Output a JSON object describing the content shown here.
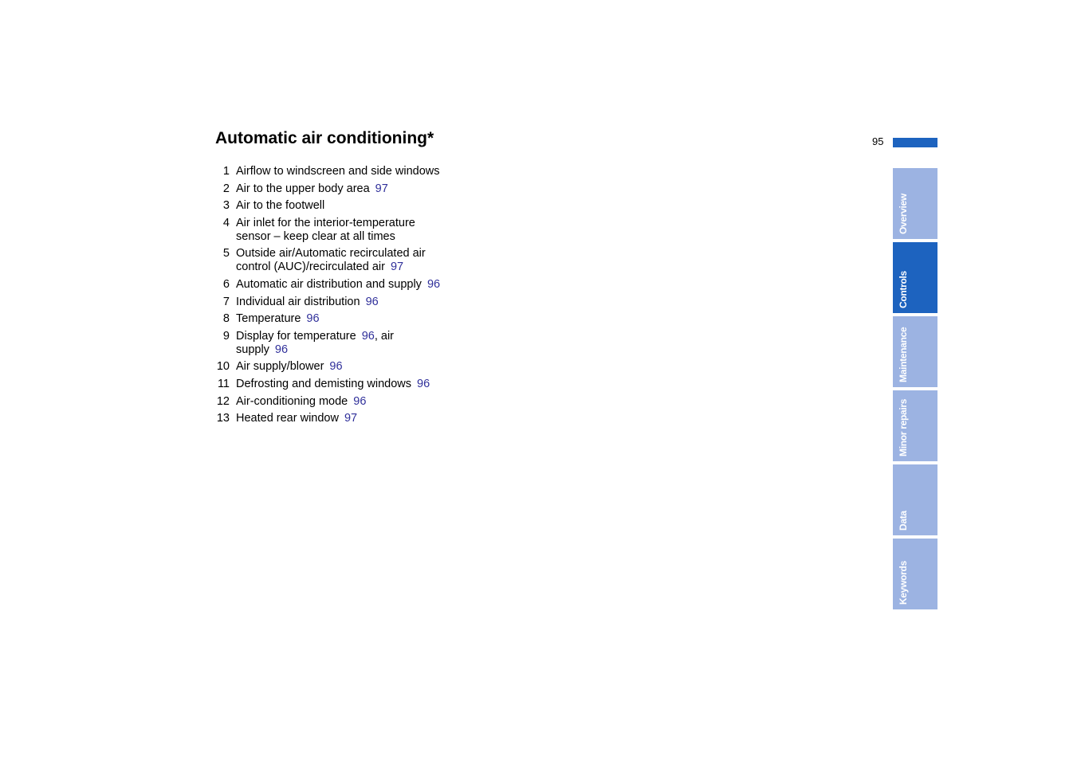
{
  "header": {
    "title": "Automatic air conditioning*",
    "page_number": "95"
  },
  "items": [
    {
      "num": "1",
      "text": "Airflow to windscreen and side windows",
      "refs": []
    },
    {
      "num": "2",
      "text": "Air to the upper body area",
      "refs": [
        "97"
      ]
    },
    {
      "num": "3",
      "text": "Air to the footwell",
      "refs": []
    },
    {
      "num": "4",
      "text": "Air inlet for the interior-temperature sensor – keep clear at all times",
      "refs": []
    },
    {
      "num": "5",
      "text": "Outside air/Automatic recirculated air control (AUC)/recirculated air",
      "refs": [
        "97"
      ]
    },
    {
      "num": "6",
      "text": "Automatic air distribution and supply",
      "refs": [
        "96"
      ]
    },
    {
      "num": "7",
      "text": "Individual air distribution",
      "refs": [
        "96"
      ]
    },
    {
      "num": "8",
      "text": "Temperature",
      "refs": [
        "96"
      ]
    },
    {
      "num": "9",
      "text": "Display for temperature",
      "refs": [
        "96"
      ],
      "text2": ", air supply",
      "refs2": [
        "96"
      ]
    },
    {
      "num": "10",
      "text": "Air supply/blower",
      "refs": [
        "96"
      ]
    },
    {
      "num": "11",
      "text": "Defrosting and demisting windows",
      "refs": [
        "96"
      ]
    },
    {
      "num": "12",
      "text": "Air-conditioning mode",
      "refs": [
        "96"
      ]
    },
    {
      "num": "13",
      "text": "Heated rear window",
      "refs": [
        "97"
      ]
    }
  ],
  "sidebar": {
    "tabs": [
      {
        "label": "Overview",
        "active": false
      },
      {
        "label": "Controls",
        "active": true
      },
      {
        "label": "Maintenance",
        "active": false
      },
      {
        "label": "Minor repairs",
        "active": false
      },
      {
        "label": "Data",
        "active": false
      },
      {
        "label": "Keywords",
        "active": false
      }
    ]
  },
  "colors": {
    "accent": "#1d63bf",
    "tab_inactive": "#9cb3e2",
    "link": "#2f2f9a"
  }
}
